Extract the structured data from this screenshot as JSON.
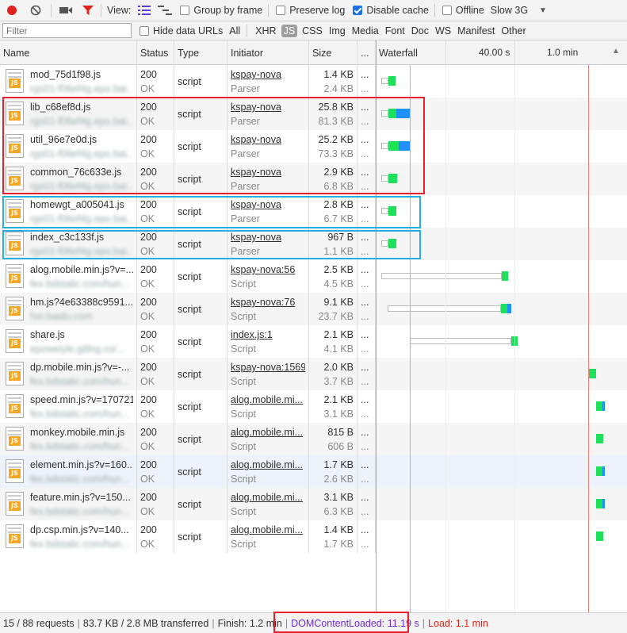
{
  "toolbar": {
    "view_label": "View:",
    "group_by_frame": "Group by frame",
    "preserve_log": "Preserve log",
    "disable_cache": "Disable cache",
    "offline": "Offline",
    "throttle": "Slow 3G"
  },
  "filterbar": {
    "placeholder": "Filter",
    "hide_data_urls": "Hide data URLs",
    "types": [
      "All",
      "XHR",
      "JS",
      "CSS",
      "Img",
      "Media",
      "Font",
      "Doc",
      "WS",
      "Manifest",
      "Other"
    ],
    "active_type": "JS"
  },
  "headers": {
    "name": "Name",
    "status": "Status",
    "type": "Type",
    "initiator": "Initiator",
    "size": "Size",
    "time": "...",
    "waterfall": "Waterfall",
    "tick1": "40.00 s",
    "tick2": "1.0 min"
  },
  "rows": [
    {
      "name": "mod_75d1f98.js",
      "domain": "rgs01-f06ef4g.epo.bai...",
      "status": "200",
      "status_text": "OK",
      "type": "script",
      "initiator": "kspay-nova",
      "initiator_type": "Parser",
      "size": "1.4 KB",
      "content": "2.4 KB",
      "time": "...",
      "time2": "..."
    },
    {
      "name": "lib_c68ef8d.js",
      "domain": "rgs01-f06ef4g.epo.bai...",
      "status": "200",
      "status_text": "OK",
      "type": "script",
      "initiator": "kspay-nova",
      "initiator_type": "Parser",
      "size": "25.8 KB",
      "content": "81.3 KB",
      "time": "...",
      "time2": "..."
    },
    {
      "name": "util_96e7e0d.js",
      "domain": "rgs01-f06ef4g.epo.bai...",
      "status": "200",
      "status_text": "OK",
      "type": "script",
      "initiator": "kspay-nova",
      "initiator_type": "Parser",
      "size": "25.2 KB",
      "content": "73.3 KB",
      "time": "...",
      "time2": "..."
    },
    {
      "name": "common_76c633e.js",
      "domain": "rgs01-f06ef4g.epo.bai...",
      "status": "200",
      "status_text": "OK",
      "type": "script",
      "initiator": "kspay-nova",
      "initiator_type": "Parser",
      "size": "2.9 KB",
      "content": "6.8 KB",
      "time": "...",
      "time2": "..."
    },
    {
      "name": "homewgt_a005041.js",
      "domain": "rgs01-f06ef4g.epo.bai...",
      "status": "200",
      "status_text": "OK",
      "type": "script",
      "initiator": "kspay-nova",
      "initiator_type": "Parser",
      "size": "2.8 KB",
      "content": "6.7 KB",
      "time": "...",
      "time2": "..."
    },
    {
      "name": "index_c3c133f.js",
      "domain": "rgs01-f06ef4g.epo.bai...",
      "status": "200",
      "status_text": "OK",
      "type": "script",
      "initiator": "kspay-nova",
      "initiator_type": "Parser",
      "size": "967 B",
      "content": "1.1 KB",
      "time": "...",
      "time2": "..."
    },
    {
      "name": "alog.mobile.min.js?v=...",
      "domain": "fex.bdstatic.com/hun...",
      "status": "200",
      "status_text": "OK",
      "type": "script",
      "initiator": "kspay-nova:56",
      "initiator_type": "Script",
      "size": "2.5 KB",
      "content": "4.5 KB",
      "time": "...",
      "time2": "..."
    },
    {
      "name": "hm.js?4e63388c9591...",
      "domain": "hm.baidu.com",
      "status": "200",
      "status_text": "OK",
      "type": "script",
      "initiator": "kspay-nova:76",
      "initiator_type": "Script",
      "size": "9.1 KB",
      "content": "23.7 KB",
      "time": "...",
      "time2": "..."
    },
    {
      "name": "share.js",
      "domain": "epoweiyle.gitlng.co/...",
      "status": "200",
      "status_text": "OK",
      "type": "script",
      "initiator": "index.js:1",
      "initiator_type": "Script",
      "size": "2.1 KB",
      "content": "4.1 KB",
      "time": "...",
      "time2": "..."
    },
    {
      "name": "dp.mobile.min.js?v=-...",
      "domain": "fex.bdstatic.com/hun...",
      "status": "200",
      "status_text": "OK",
      "type": "script",
      "initiator": "kspay-nova:1569",
      "initiator_type": "Script",
      "size": "2.0 KB",
      "content": "3.7 KB",
      "time": "...",
      "time2": "..."
    },
    {
      "name": "speed.min.js?v=170721",
      "domain": "fex.bdstatic.com/hun...",
      "status": "200",
      "status_text": "OK",
      "type": "script",
      "initiator": "alog.mobile.mi...",
      "initiator_type": "Script",
      "size": "2.1 KB",
      "content": "3.1 KB",
      "time": "...",
      "time2": "..."
    },
    {
      "name": "monkey.mobile.min.js",
      "domain": "fex.bdstatic.com/hun...",
      "status": "200",
      "status_text": "OK",
      "type": "script",
      "initiator": "alog.mobile.mi...",
      "initiator_type": "Script",
      "size": "815 B",
      "content": "606 B",
      "time": "...",
      "time2": "..."
    },
    {
      "name": "element.min.js?v=160...",
      "domain": "fex.bdstatic.com/hun...",
      "status": "200",
      "status_text": "OK",
      "type": "script",
      "initiator": "alog.mobile.mi...",
      "initiator_type": "Script",
      "size": "1.7 KB",
      "content": "2.6 KB",
      "time": "...",
      "time2": "..."
    },
    {
      "name": "feature.min.js?v=150...",
      "domain": "fex.bdstatic.com/hun...",
      "status": "200",
      "status_text": "OK",
      "type": "script",
      "initiator": "alog.mobile.mi...",
      "initiator_type": "Script",
      "size": "3.1 KB",
      "content": "6.3 KB",
      "time": "...",
      "time2": "..."
    },
    {
      "name": "dp.csp.min.js?v=140...",
      "domain": "fex.bdstatic.com/hun...",
      "status": "200",
      "status_text": "OK",
      "type": "script",
      "initiator": "alog.mobile.mi...",
      "initiator_type": "Script",
      "size": "1.4 KB",
      "content": "1.7 KB",
      "time": "...",
      "time2": "..."
    }
  ],
  "statusbar": {
    "requests": "15 / 88 requests",
    "transferred": "83.7 KB / 2.8 MB transferred",
    "finish": "Finish: 1.2 min",
    "dcl": "DOMContentLoaded: 11.19 s",
    "load": "Load: 1.1 min"
  },
  "colors": {
    "dcl_line": "#8b6cf0",
    "load_line": "#e8202c",
    "ttfb": "#1ee05a",
    "download": "#1e90ff",
    "highlight_red": "#e8202c",
    "highlight_blue": "#27aee0"
  }
}
